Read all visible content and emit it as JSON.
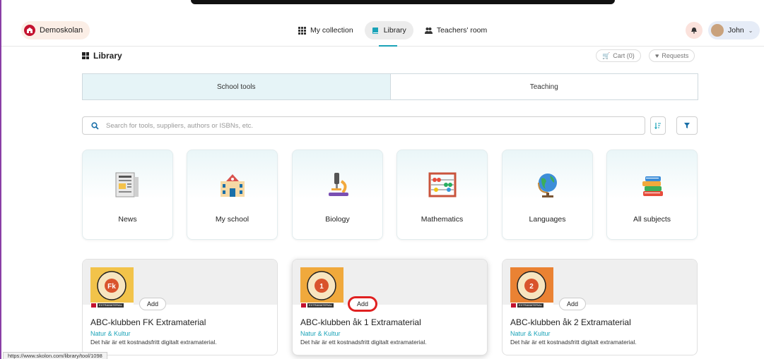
{
  "header": {
    "brand_label": "Demoskolan",
    "nav": [
      {
        "label": "My collection",
        "icon": "grid-icon"
      },
      {
        "label": "Library",
        "icon": "book-icon"
      },
      {
        "label": "Teachers' room",
        "icon": "people-icon"
      }
    ],
    "user_label": "John"
  },
  "page": {
    "title": "Library",
    "cart_label": "Cart (0)",
    "requests_label": "Requests"
  },
  "tabs": [
    "School tools",
    "Teaching"
  ],
  "search": {
    "placeholder": "Search for tools, suppliers, authors or ISBNs, etc."
  },
  "categories": [
    {
      "label": "News",
      "icon": "newspaper-icon"
    },
    {
      "label": "My school",
      "icon": "school-building-icon"
    },
    {
      "label": "Biology",
      "icon": "microscope-icon"
    },
    {
      "label": "Mathematics",
      "icon": "abacus-icon"
    },
    {
      "label": "Languages",
      "icon": "globe-icon"
    },
    {
      "label": "All subjects",
      "icon": "books-stack-icon"
    }
  ],
  "products": [
    {
      "title": "ABC-klubben FK Extramaterial",
      "publisher": "Natur & Kultur",
      "description": "Det här är ett kostnadsfritt digitalt extramaterial.",
      "add_label": "Add",
      "cover_mark": "Fk",
      "cover_color": "#f2c34a",
      "strip_label": "EXTRAMATERIAL"
    },
    {
      "title": "ABC-klubben åk 1 Extramaterial",
      "publisher": "Natur & Kultur",
      "description": "Det här är ett kostnadsfritt digitalt extramaterial.",
      "add_label": "Add",
      "cover_mark": "1",
      "cover_color": "#f0a93c",
      "strip_label": "EXTRAMATERIAL"
    },
    {
      "title": "ABC-klubben åk 2 Extramaterial",
      "publisher": "Natur & Kultur",
      "description": "Det här är ett kostnadsfritt digitalt extramaterial.",
      "add_label": "Add",
      "cover_mark": "2",
      "cover_color": "#ea8233",
      "strip_label": "EXTRAMATERIAL"
    }
  ],
  "cover_ring_text": "ABC-KLUBBEN",
  "status_url": "https://www.skolon.com/library/tool/1098",
  "colors": {
    "accent": "#1aa3b8",
    "highlight": "#e02020",
    "brand_bg": "#fbeee6"
  }
}
